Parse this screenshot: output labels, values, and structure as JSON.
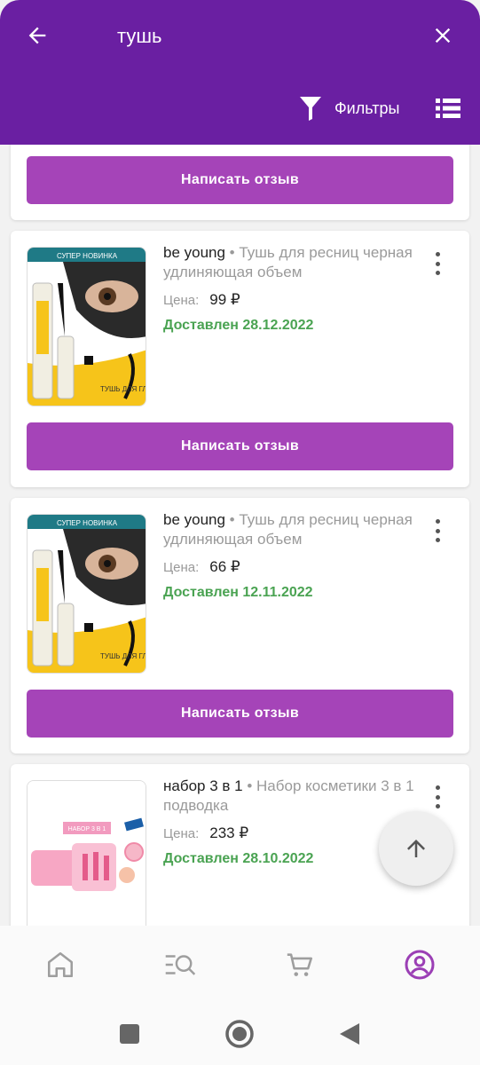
{
  "header": {
    "search_query": "тушь",
    "filters_label": "Фильтры",
    "colors": {
      "background": "#6a1fa2"
    }
  },
  "review_button_label": "Написать отзыв",
  "orders": [
    {
      "brand": "be young",
      "title": "Тушь для ресниц черная удлиняющая объем",
      "price_label": "Цена:",
      "price": "99 ₽",
      "status": "Доставлен 28.12.2022"
    },
    {
      "brand": "be young",
      "title": "Тушь для ресниц черная удлиняющая объем",
      "price_label": "Цена:",
      "price": "66 ₽",
      "status": "Доставлен 12.11.2022"
    },
    {
      "brand": "набор 3 в 1",
      "title": "Набор косметики 3 в 1 подводка",
      "price_label": "Цена:",
      "price": "233 ₽",
      "status": "Доставлен 28.10.2022"
    }
  ],
  "product_image_text": {
    "banner": "СУПЕР НОВИНКА",
    "caption": "ТУШЬ ДЛЯ ГЛАЗ",
    "set_banner": "НАБОР 3 В 1"
  },
  "bottom_nav": {
    "items": [
      "home-icon",
      "catalog-search-icon",
      "cart-icon",
      "profile-icon"
    ],
    "active": "profile-icon"
  },
  "colors": {
    "accent": "#a544b8",
    "delivered": "#4aa352",
    "nav_active": "#9b3fb5"
  }
}
